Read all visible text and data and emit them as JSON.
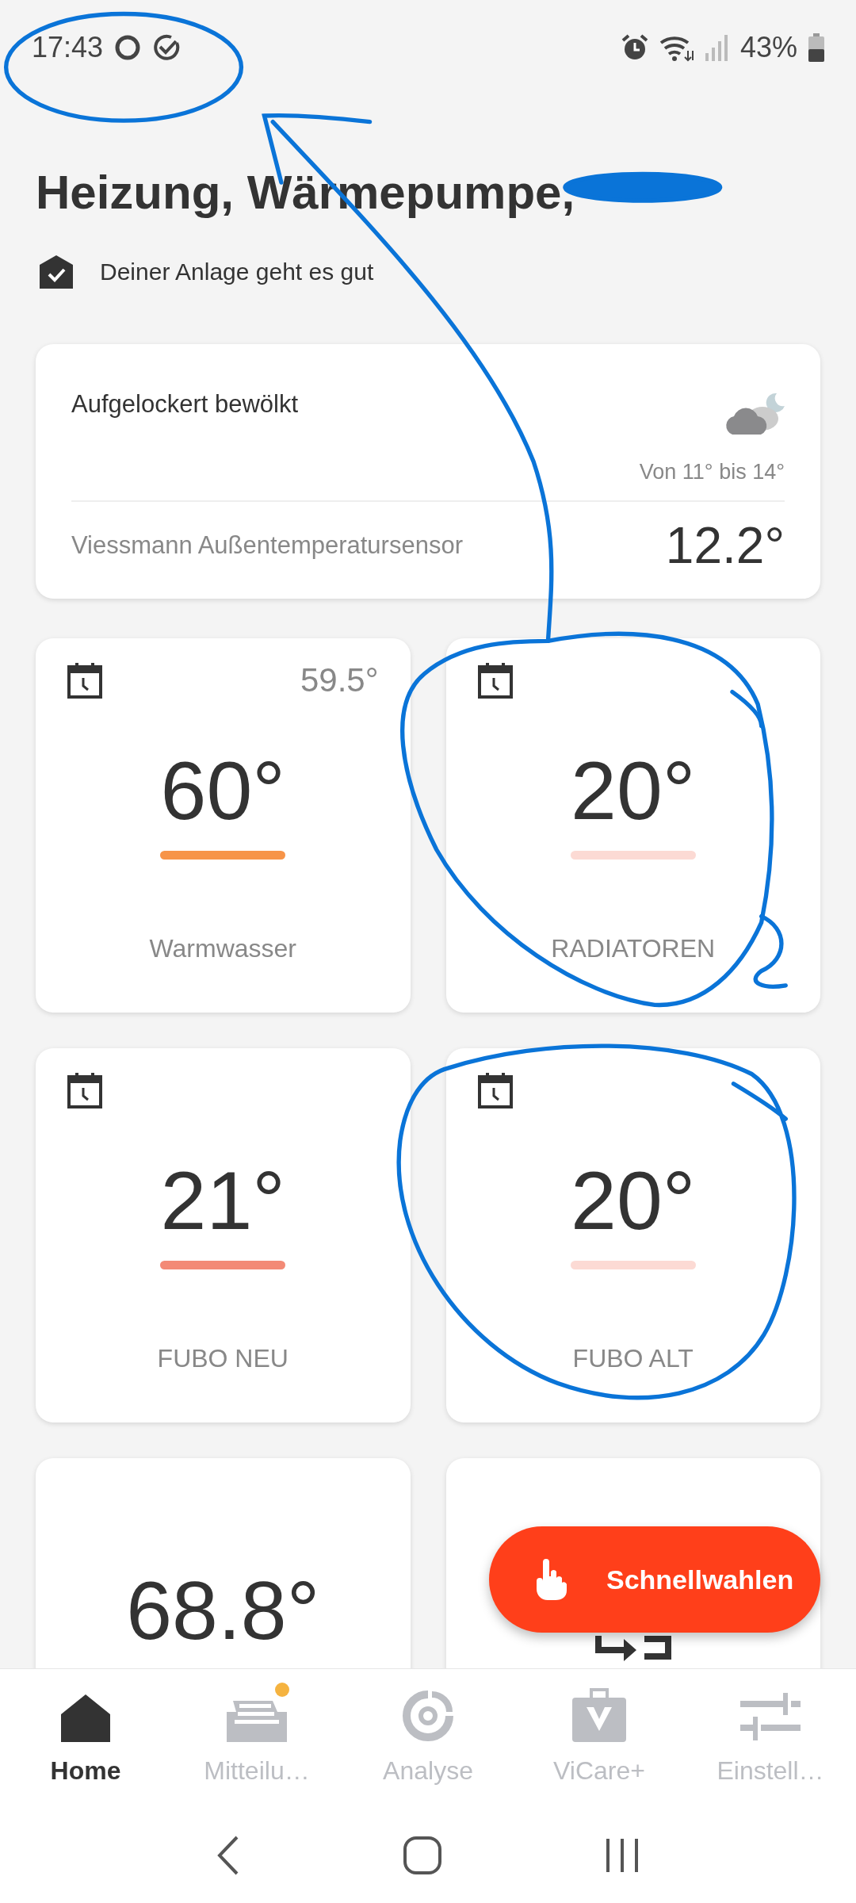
{
  "status_bar": {
    "time": "17:43",
    "battery": "43%"
  },
  "header": {
    "title": "Heizung, Wärmepumpe,",
    "status": "Deiner Anlage geht es gut"
  },
  "weather": {
    "condition": "Aufgelockert bewölkt",
    "range": "Von 11° bis 14°",
    "sensor": "Viessmann Außentemperatursensor",
    "temperature": "12.2°"
  },
  "tiles": [
    {
      "kind": "circuit",
      "target": "60°",
      "current": "59.5°",
      "label": "Warmwasser",
      "color": "#f79448"
    },
    {
      "kind": "circuit",
      "target": "20°",
      "label": "RADIATOREN",
      "color": "#fcdad4"
    },
    {
      "kind": "circuit",
      "target": "21°",
      "label": "FUBO NEU",
      "color": "#f38a76"
    },
    {
      "kind": "circuit",
      "target": "20°",
      "label": "FUBO ALT",
      "color": "#fcdad4"
    },
    {
      "kind": "reading",
      "value": "68.8°"
    },
    {
      "kind": "icon"
    }
  ],
  "fab": {
    "label": "Schnellwahlen"
  },
  "nav": [
    {
      "label": "Home",
      "selected": true,
      "badge": false
    },
    {
      "label": "Mitteilu…",
      "selected": false,
      "badge": true
    },
    {
      "label": "Analyse",
      "selected": false,
      "badge": false
    },
    {
      "label": "ViCare+",
      "selected": false,
      "badge": false
    },
    {
      "label": "Einstell…",
      "selected": false,
      "badge": false
    }
  ]
}
